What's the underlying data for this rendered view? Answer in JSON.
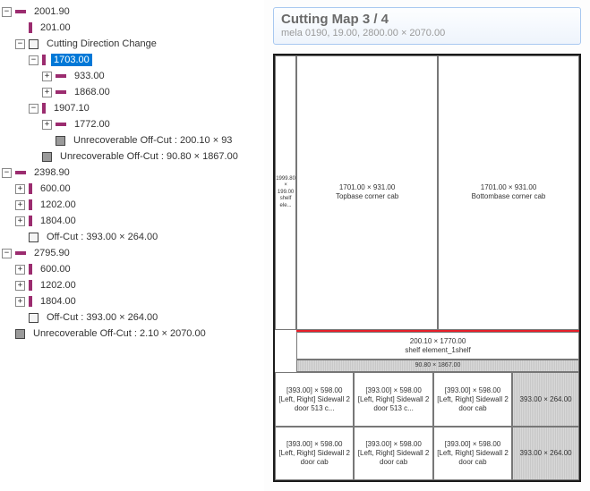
{
  "tree": {
    "n0": "2001.90",
    "n0_0": "201.00",
    "n0_1": "Cutting Direction Change",
    "n0_1_0": "1703.00",
    "n0_1_0_0": "933.00",
    "n0_1_0_1": "1868.00",
    "n0_1_1": "1907.10",
    "n0_1_1_0": "1772.00",
    "n0_1_1_1": "Unrecoverable Off-Cut : 200.10 × 93",
    "n0_1_2": "Unrecoverable Off-Cut : 90.80 × 1867.00",
    "n1": "2398.90",
    "n1_0": "600.00",
    "n1_1": "1202.00",
    "n1_2": "1804.00",
    "n1_3": "Off-Cut : 393.00 × 264.00",
    "n2": "2795.90",
    "n2_0": "600.00",
    "n2_1": "1202.00",
    "n2_2": "1804.00",
    "n2_3": "Off-Cut : 393.00 × 264.00",
    "n3": "Unrecoverable Off-Cut : 2.10 × 2070.00"
  },
  "map": {
    "title": "Cutting Map 3 / 4",
    "subtitle": "mela 0190, 19.00, 2800.00 × 2070.00",
    "p_left_small_dim": "1999.80 × 199.00",
    "p_left_small_nm": "shelf ele...",
    "p_top_a_dim": "1701.00 × 931.00",
    "p_top_a_nm": "Topbase corner cab",
    "p_top_b_dim": "1701.00 × 931.00",
    "p_top_b_nm": "Bottombase corner cab",
    "p_shelf_dim": "200.10 × 1770.00",
    "p_shelf_nm": "shelf element_1shelf",
    "p_off_strip": "90.80 × 1867.00",
    "p_s1_dim": "[393.00] × 598.00",
    "p_s1_nm": "[Left, Right] Sidewall 2 door 513 c...",
    "p_s2_dim": "[393.00] × 598.00",
    "p_s2_nm": "[Left, Right] Sidewall 2 door 513 c...",
    "p_s3_dim": "[393.00] × 598.00",
    "p_s3_nm": "[Left, Right] Sidewall 2 door cab",
    "p_s4_dim": "[393.00] × 598.00",
    "p_s4_nm": "[Left, Right] Sidewall 2 door cab",
    "p_s5_dim": "[393.00] × 598.00",
    "p_s5_nm": "[Left, Right] Sidewall 2 door cab",
    "p_s6_dim": "[393.00] × 598.00",
    "p_s6_nm": "[Left, Right] Sidewall 2 door cab",
    "p_off_a": "393.00 × 264.00",
    "p_off_b": "393.00 × 264.00"
  }
}
